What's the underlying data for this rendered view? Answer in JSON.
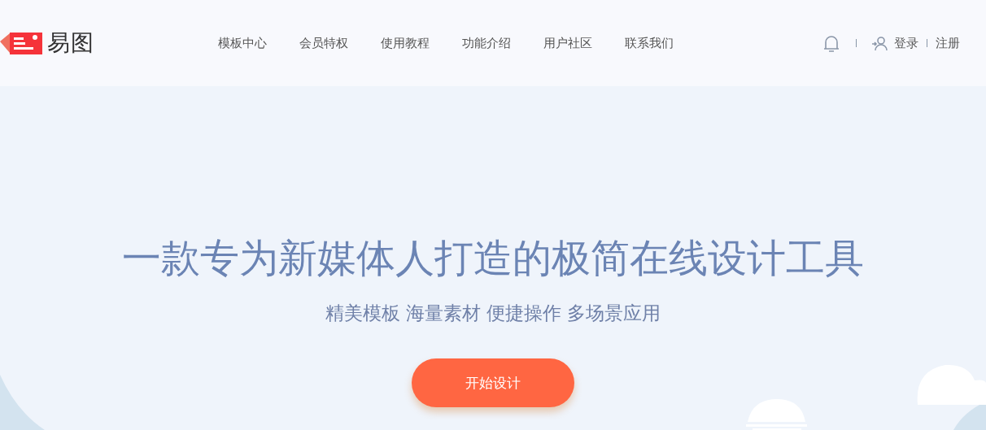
{
  "header": {
    "logo_text": "易图",
    "nav": [
      {
        "label": "模板中心"
      },
      {
        "label": "会员特权"
      },
      {
        "label": "使用教程"
      },
      {
        "label": "功能介绍"
      },
      {
        "label": "用户社区"
      },
      {
        "label": "联系我们"
      }
    ],
    "login": "登录",
    "register": "注册"
  },
  "hero": {
    "title": "一款专为新媒体人打造的极简在线设计工具",
    "subtitle": "精美模板 海量素材 便捷操作 多场景应用",
    "cta": "开始设计"
  }
}
